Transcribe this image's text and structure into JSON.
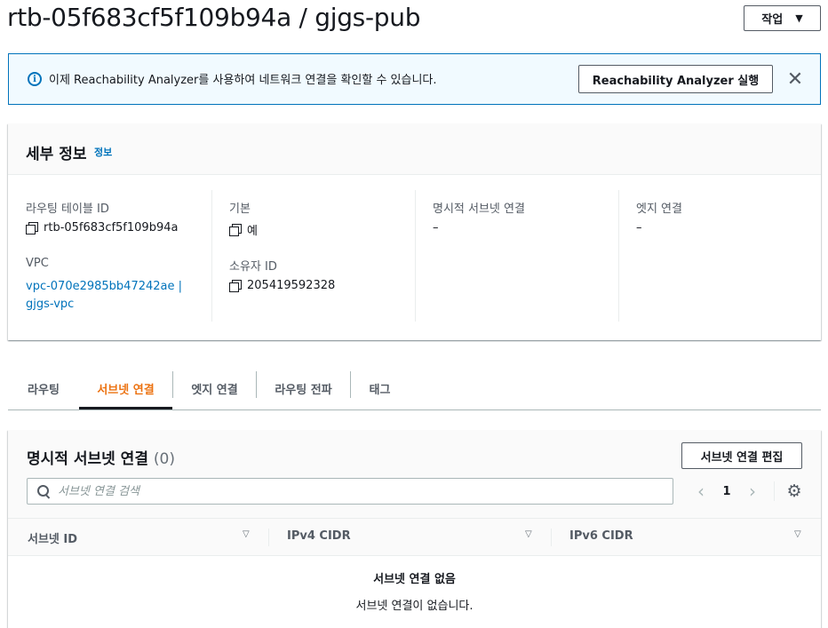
{
  "header": {
    "title": "rtb-05f683cf5f109b94a / gjgs-pub",
    "actions_label": "작업",
    "actions_caret": "▼"
  },
  "banner": {
    "info_glyph": "i",
    "text": "이제 Reachability Analyzer를 사용하여 네트워크 연결을 확인할 수 있습니다.",
    "button_label": "Reachability Analyzer 실행",
    "close_glyph": "✕"
  },
  "details": {
    "title": "세부 정보",
    "info_link": "정보",
    "fields": {
      "route_table_id": {
        "label": "라우팅 테이블 ID",
        "value": "rtb-05f683cf5f109b94a"
      },
      "vpc": {
        "label": "VPC",
        "value_line1": "vpc-070e2985bb47242ae |",
        "value_line2": "gjgs-vpc"
      },
      "main": {
        "label": "기본",
        "value": "예"
      },
      "owner_id": {
        "label": "소유자 ID",
        "value": "205419592328"
      },
      "explicit_subnet": {
        "label": "명시적 서브넷 연결",
        "value": "–"
      },
      "edge": {
        "label": "엣지 연결",
        "value": "–"
      }
    }
  },
  "tabs": [
    {
      "label": "라우팅",
      "active": false
    },
    {
      "label": "서브넷 연결",
      "active": true
    },
    {
      "label": "엣지 연결",
      "active": false
    },
    {
      "label": "라우팅 전파",
      "active": false
    },
    {
      "label": "태그",
      "active": false
    }
  ],
  "subnet_table": {
    "title": "명시적 서브넷 연결",
    "count": "(0)",
    "edit_button": "서브넷 연결 편집",
    "search_placeholder": "서브넷 연결 검색",
    "pagination": {
      "prev": "‹",
      "page": "1",
      "next": "›"
    },
    "settings_glyph": "⚙",
    "columns": [
      {
        "label": "서브넷 ID",
        "sort": "▽"
      },
      {
        "label": "IPv4 CIDR",
        "sort": "▽"
      },
      {
        "label": "IPv6 CIDR",
        "sort": "▽"
      }
    ],
    "empty_title": "서브넷 연결 없음",
    "empty_text": "서브넷 연결이 없습니다."
  },
  "colors": {
    "accent_blue": "#0073bb",
    "active_tab": "#ec7211",
    "banner_bg": "#f1faff"
  }
}
